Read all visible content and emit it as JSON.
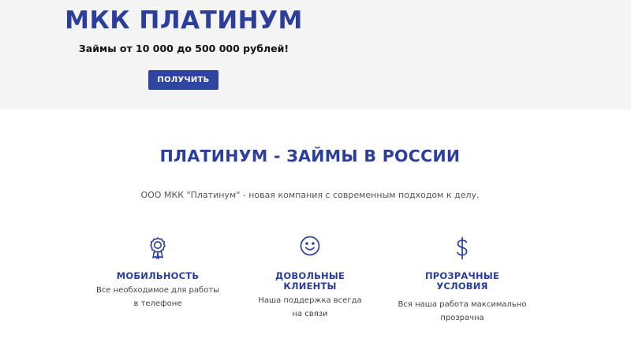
{
  "hero": {
    "title": "МКК ПЛАТИНУМ",
    "subtitle": "Займы от 10 000 до 500 000 рублей!",
    "button_label": "ПОЛУЧИТЬ"
  },
  "about": {
    "title": "ПЛАТИНУМ - ЗАЙМЫ В РОССИИ",
    "description": "ООО МКК \"Платинум\" - новая компания с современным подходом к делу."
  },
  "features": [
    {
      "icon": "award-icon",
      "title_lines": [
        "МОБИЛЬНОСТЬ"
      ],
      "text_lines": [
        "Все необходимое для работы",
        "в телефоне"
      ]
    },
    {
      "icon": "smile-icon",
      "title_lines": [
        "ДОВОЛЬНЫЕ",
        "КЛИЕНТЫ"
      ],
      "text_lines": [
        "Наша поддержка всегда",
        "на связи"
      ]
    },
    {
      "icon": "dollar-icon",
      "title_lines": [
        "ПРОЗРАЧНЫЕ",
        "УСЛОВИЯ"
      ],
      "text_lines": [
        "Вся наша работа максимально",
        "прозрачна"
      ]
    }
  ],
  "colors": {
    "accent": "#2b3e9c",
    "button": "#2f45a0",
    "hero_bg": "#f4f4f4"
  }
}
